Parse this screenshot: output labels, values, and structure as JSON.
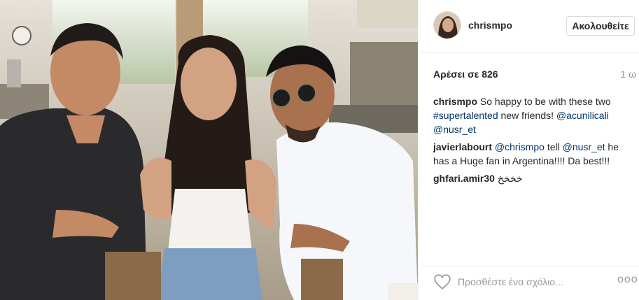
{
  "photo": {
    "description_icon": "photo-icon"
  },
  "header": {
    "username": "chrismpo",
    "follow_label": "Ακολουθείτε"
  },
  "stats": {
    "likes": "Αρέσει σε 826",
    "time": "1 ω"
  },
  "comments": [
    {
      "user": "chrismpo",
      "parts": [
        "So happy to be with these two ",
        "#supertalented",
        " new friends! ",
        "@acunilicali",
        " ",
        "@nusr_et"
      ]
    },
    {
      "user": "javierlabourt",
      "parts": [
        "@chrismpo",
        " tell ",
        "@nusr_et",
        " he has a Huge fan in Argentina!!!! Da best!!!"
      ]
    },
    {
      "user": "ghfari.amir30",
      "parts": [
        "خخخخ"
      ]
    }
  ],
  "footer": {
    "comment_placeholder": "Προσθέστε ένα σχόλιο...",
    "more_label": "ooo",
    "like_icon": "heart-icon"
  },
  "colors": {
    "link": "#003569",
    "border": "#efefef",
    "muted": "#999999",
    "text": "#262626"
  }
}
